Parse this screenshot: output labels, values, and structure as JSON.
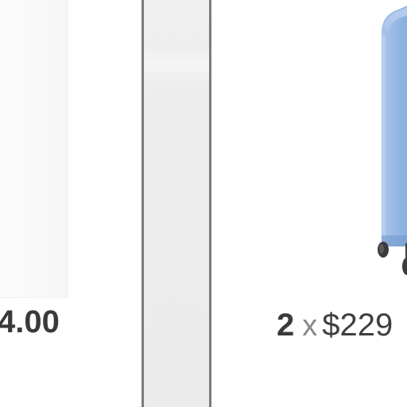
{
  "left_card": {
    "price_text": "4.00"
  },
  "right_card": {
    "quantity": "2",
    "times_sign": "x",
    "unit_price_text": "$229"
  },
  "colors": {
    "text_dark": "#3a3a3a",
    "text_muted": "#888888",
    "divider_border": "#7b7b7b",
    "divider_fill": "#ebebeb",
    "product_blue": "#8fb3e0"
  },
  "icons": {
    "product_image": "blue-rolling-cabinet"
  }
}
